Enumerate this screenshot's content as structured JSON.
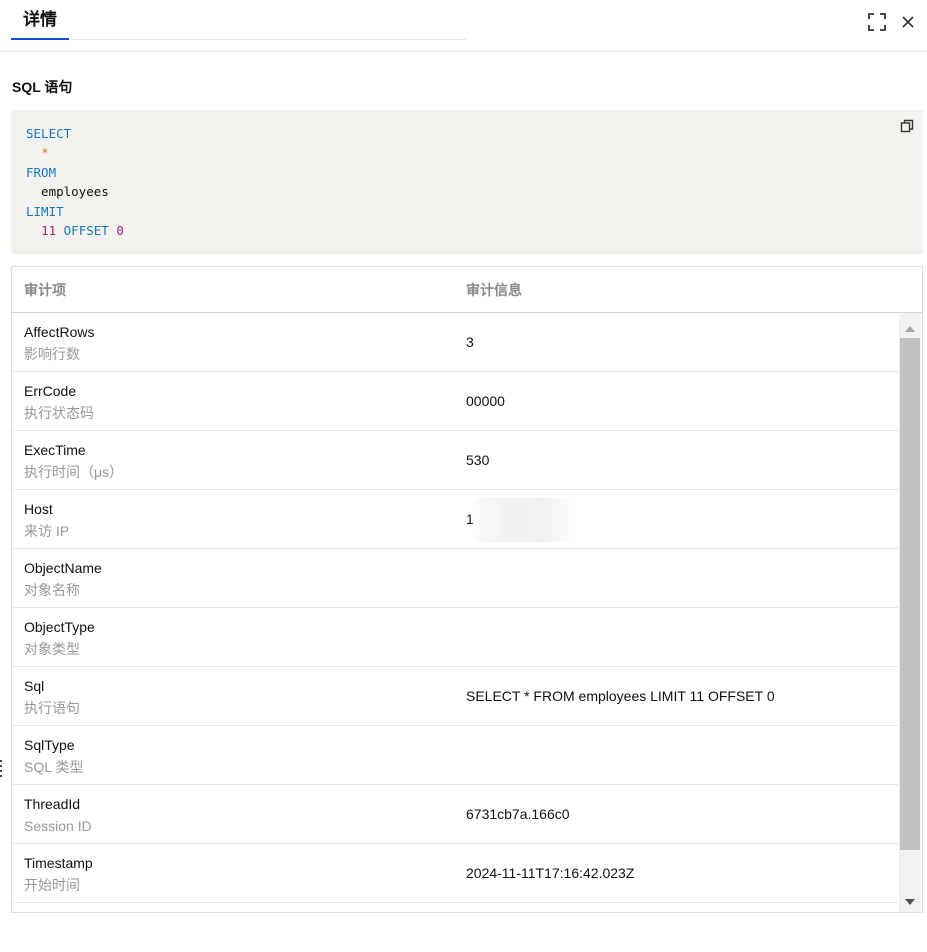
{
  "header": {
    "tab_label": "详情"
  },
  "section": {
    "title": "SQL 语句"
  },
  "sql": {
    "lines": [
      {
        "parts": [
          {
            "t": "SELECT",
            "c": "kw"
          }
        ]
      },
      {
        "parts": [
          {
            "t": "  ",
            "c": ""
          },
          {
            "t": "*",
            "c": "op"
          }
        ]
      },
      {
        "parts": [
          {
            "t": "FROM",
            "c": "kw"
          }
        ]
      },
      {
        "parts": [
          {
            "t": "  employees",
            "c": ""
          }
        ]
      },
      {
        "parts": [
          {
            "t": "LIMIT",
            "c": "kw"
          }
        ]
      },
      {
        "parts": [
          {
            "t": "  ",
            "c": ""
          },
          {
            "t": "11",
            "c": "num"
          },
          {
            "t": " ",
            "c": ""
          },
          {
            "t": "OFFSET",
            "c": "kw"
          },
          {
            "t": " ",
            "c": ""
          },
          {
            "t": "0",
            "c": "num"
          }
        ]
      }
    ]
  },
  "table": {
    "columns": [
      "审计项",
      "审计信息"
    ],
    "rows": [
      {
        "key": "AffectRows",
        "desc": "影响行数",
        "value": "3"
      },
      {
        "key": "ErrCode",
        "desc": "执行状态码",
        "value": "00000"
      },
      {
        "key": "ExecTime",
        "desc": "执行时间（μs）",
        "value": "530"
      },
      {
        "key": "Host",
        "desc": "来访 IP",
        "value": "1",
        "blurred": true
      },
      {
        "key": "ObjectName",
        "desc": "对象名称",
        "value": ""
      },
      {
        "key": "ObjectType",
        "desc": "对象类型",
        "value": ""
      },
      {
        "key": "Sql",
        "desc": "执行语句",
        "value": "SELECT * FROM employees LIMIT 11 OFFSET 0"
      },
      {
        "key": "SqlType",
        "desc": "SQL 类型",
        "value": ""
      },
      {
        "key": "ThreadId",
        "desc": "Session ID",
        "value": "6731cb7a.166c0"
      },
      {
        "key": "Timestamp",
        "desc": "开始时间",
        "value": "2024-11-11T17:16:42.023Z"
      }
    ]
  },
  "icons": {
    "fullscreen": "fullscreen-icon",
    "close": "close-icon",
    "copy": "copy-icon",
    "drag": "drag-handle-icon"
  },
  "colors": {
    "accent": "#0052d9",
    "keyword": "#1777bd",
    "number": "#a0237c"
  }
}
